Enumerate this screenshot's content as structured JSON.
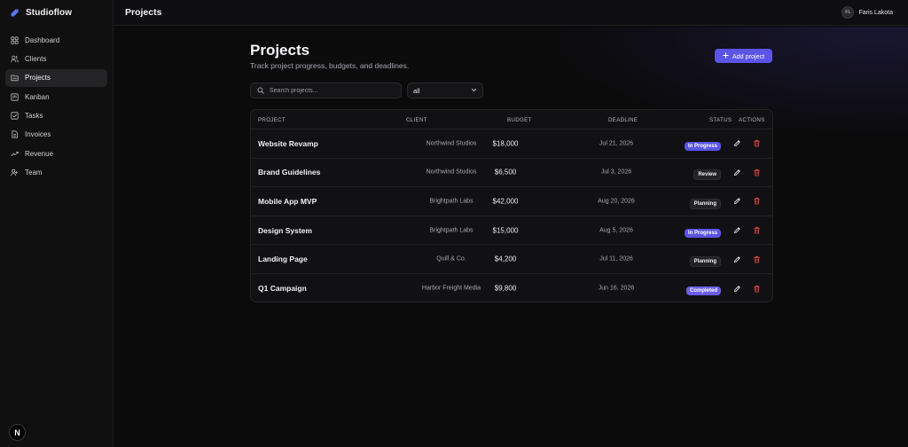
{
  "app": {
    "name": "Studioflow"
  },
  "sidebar": {
    "items": [
      {
        "label": "Dashboard",
        "icon": "grid-icon"
      },
      {
        "label": "Clients",
        "icon": "users-icon"
      },
      {
        "label": "Projects",
        "icon": "folder-icon",
        "active": true
      },
      {
        "label": "Kanban",
        "icon": "kanban-icon"
      },
      {
        "label": "Tasks",
        "icon": "checkbox-icon"
      },
      {
        "label": "Invoices",
        "icon": "document-icon"
      },
      {
        "label": "Revenue",
        "icon": "trend-icon"
      },
      {
        "label": "Team",
        "icon": "team-icon"
      }
    ],
    "footer_badge": "N"
  },
  "topbar": {
    "title": "Projects",
    "user": {
      "initials": "FL",
      "name": "Faris Lakota"
    }
  },
  "page": {
    "title": "Projects",
    "subtitle": "Track project progress, budgets, and deadlines.",
    "add_button": "Add project",
    "search": {
      "placeholder": "Search projects..."
    },
    "filter": {
      "value": "all"
    }
  },
  "table": {
    "headers": {
      "project": "PROJECT",
      "client": "CLIENT",
      "budget": "BUDGET",
      "deadline": "DEADLINE",
      "status": "STATUS",
      "actions": "ACTIONS"
    },
    "rows": [
      {
        "project": "Website Revamp",
        "client": "Northwind Studios",
        "budget": "$18,000",
        "deadline": "Jul 21, 2026",
        "status": "In Progress",
        "status_kind": "inprogress"
      },
      {
        "project": "Brand Guidelines",
        "client": "Northwind Studios",
        "budget": "$6,500",
        "deadline": "Jul 3, 2026",
        "status": "Review",
        "status_kind": "neutral"
      },
      {
        "project": "Mobile App MVP",
        "client": "Brightpath Labs",
        "budget": "$42,000",
        "deadline": "Aug 20, 2026",
        "status": "Planning",
        "status_kind": "neutral"
      },
      {
        "project": "Design System",
        "client": "Brightpath Labs",
        "budget": "$15,000",
        "deadline": "Aug 5, 2026",
        "status": "In Progress",
        "status_kind": "inprogress"
      },
      {
        "project": "Landing Page",
        "client": "Quill & Co.",
        "budget": "$4,200",
        "deadline": "Jul 11, 2026",
        "status": "Planning",
        "status_kind": "neutral"
      },
      {
        "project": "Q1 Campaign",
        "client": "Harbor Freight Media",
        "budget": "$9,800",
        "deadline": "Jun 16, 2026",
        "status": "Completed",
        "status_kind": "completed"
      }
    ]
  },
  "colors": {
    "accent": "#5b54e6",
    "delete": "#e5484d"
  }
}
